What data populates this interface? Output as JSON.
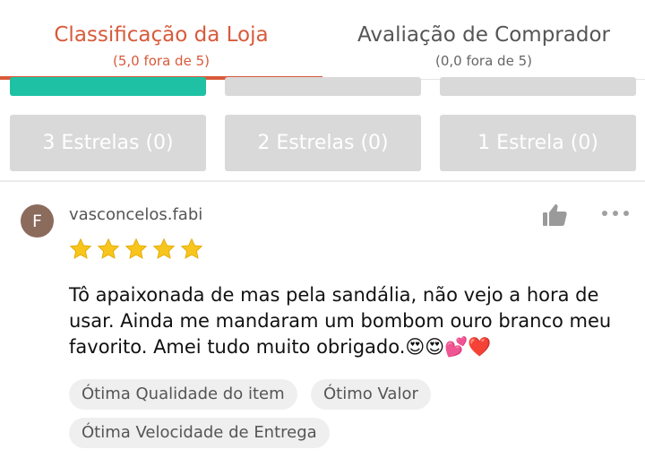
{
  "tabs": {
    "store_rating": {
      "title": "Classificação da Loja",
      "subtitle": "(5,0 fora de 5)"
    },
    "buyer_rating": {
      "title": "Avaliação de Comprador",
      "subtitle": "(0,0 fora de 5)"
    }
  },
  "filters": {
    "three_stars": "3 Estrelas (0)",
    "two_stars": "2 Estrelas (0)",
    "one_star": "1 Estrela (0)"
  },
  "review": {
    "avatar_initial": "F",
    "username": "vasconcelos.fabi",
    "rating": 5,
    "text": "Tô apaixonada de mas pela sandália, não vejo a hora de usar. Ainda me mandaram um bombom ouro branco meu favorito. Amei tudo muito obrigado.😍😍💕❤️",
    "tags": [
      "Ótima Qualidade do item",
      "Ótimo Valor",
      "Ótima Velocidade de Entrega"
    ]
  },
  "icons": {
    "like": "thumbs-up-icon",
    "more": "more-options-icon",
    "star": "star-icon"
  },
  "colors": {
    "accent": "#d85a3b",
    "active_filter": "#1fc1a5",
    "filter_bg": "#d9d9d9",
    "star": "#f8c51c",
    "avatar": "#8b6b5c"
  }
}
